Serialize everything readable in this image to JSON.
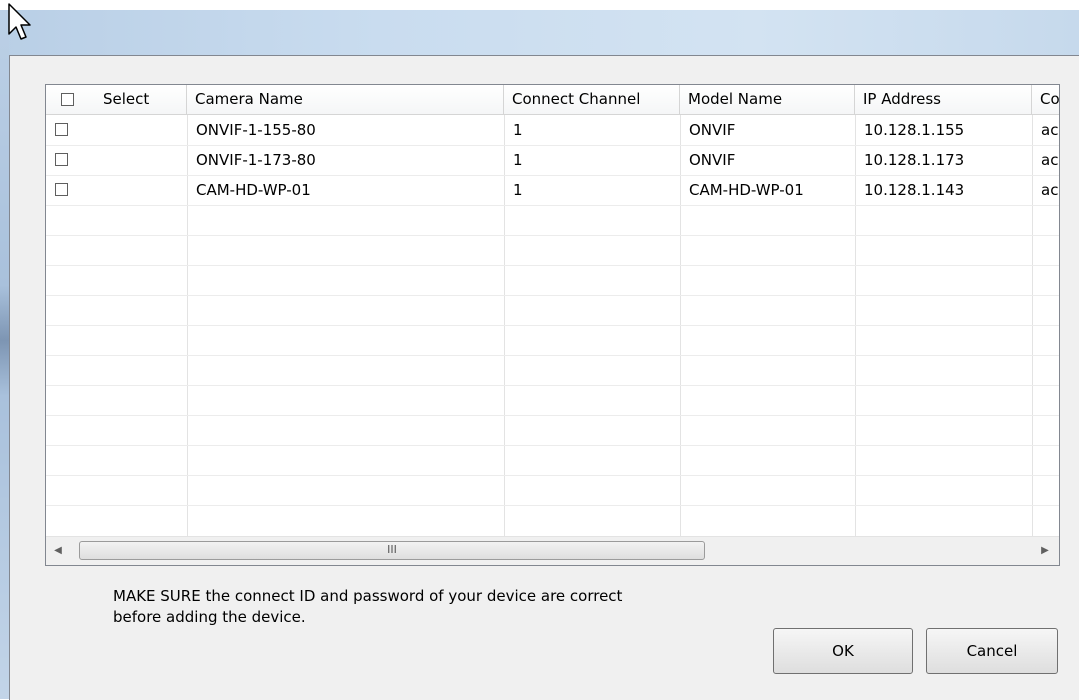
{
  "dialog": {
    "columns": [
      "Select",
      "Camera Name",
      "Connect Channel",
      "Model Name",
      "IP Address",
      "Co"
    ],
    "rows": [
      {
        "camera_name": "ONVIF-1-155-80",
        "channel": "1",
        "model": "ONVIF",
        "ip": "10.128.1.155",
        "extra": "ac"
      },
      {
        "camera_name": "ONVIF-1-173-80",
        "channel": "1",
        "model": "ONVIF",
        "ip": "10.128.1.173",
        "extra": "ac"
      },
      {
        "camera_name": "CAM-HD-WP-01",
        "channel": "1",
        "model": "CAM-HD-WP-01",
        "ip": "10.128.1.143",
        "extra": "ac"
      }
    ],
    "scrollbar": {
      "left_arrow": "◀",
      "right_arrow": "▶",
      "thumb_grip": "III"
    },
    "note_line1": "MAKE SURE the connect ID and password of your device are correct",
    "note_line2": "before adding the device.",
    "ok_label": "OK",
    "cancel_label": "Cancel"
  }
}
